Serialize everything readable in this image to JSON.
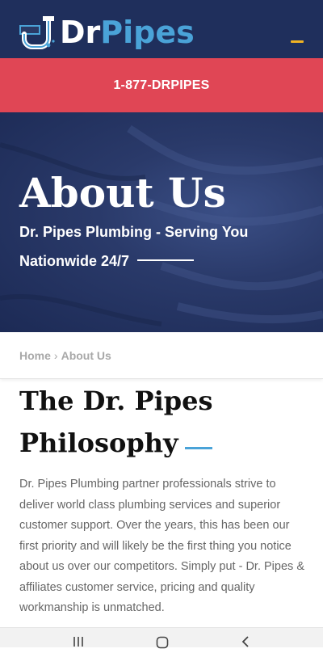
{
  "header": {
    "logo": {
      "text_dr": "Dr",
      "text_pipes": "Pipes",
      "icon": "pipe-logo-icon"
    },
    "menu_icon": "hamburger-icon",
    "accent_color": "#f0b323",
    "background_color": "#1f2f5c"
  },
  "phone_band": {
    "phone": "1-877-DRPIPES",
    "background_color": "#e04655"
  },
  "hero": {
    "title": "About Us",
    "subtitle": "Dr. Pipes Plumbing - Serving You Nationwide 24/7"
  },
  "breadcrumb": {
    "home": "Home",
    "separator": "›",
    "current": "About Us"
  },
  "section": {
    "title": "The Dr. Pipes Philosophy",
    "body": "Dr. Pipes Plumbing partner professionals strive to deliver world class plumbing services and superior customer support. Over the years, this has been our first priority and will likely be the first thing you notice about us over our competitors. Simply put - Dr. Pipes & affiliates customer service, pricing and quality workmanship is unmatched.",
    "accent_color": "#4aa3d8"
  },
  "system_nav": {
    "recents_icon": "recents-icon",
    "home_icon": "home-icon",
    "back_icon": "back-icon"
  }
}
